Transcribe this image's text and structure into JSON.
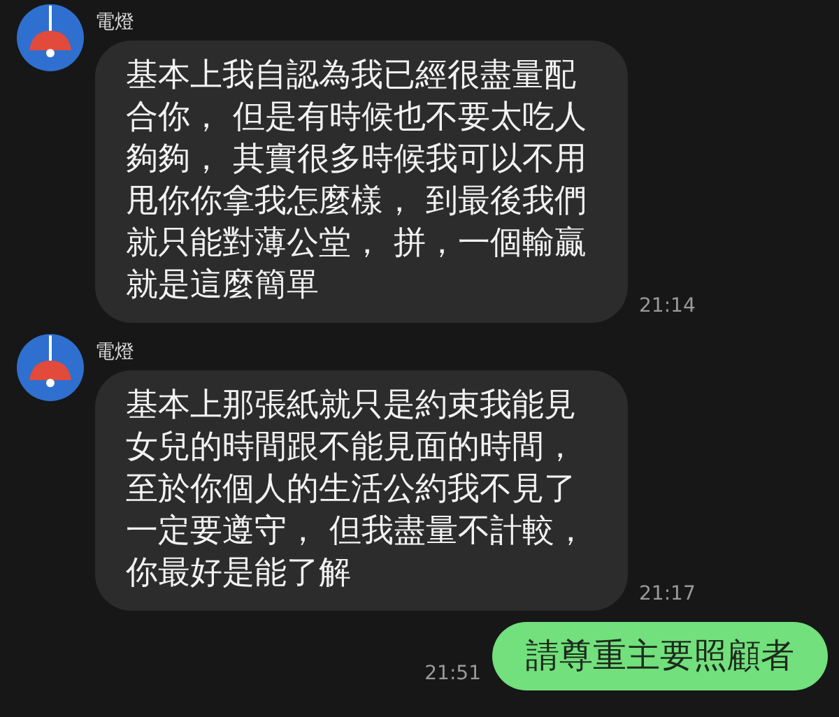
{
  "messages": [
    {
      "kind": "incoming",
      "sender": "電燈",
      "text": "基本上我自認為我已經很盡量配合你， 但是有時候也不要太吃人夠夠， 其實很多時候我可以不用甩你你拿我怎麼樣， 到最後我們就只能對薄公堂， 拼，一個輸贏就是這麼簡單",
      "time": "21:14"
    },
    {
      "kind": "incoming",
      "sender": "電燈",
      "text": "基本上那張紙就只是約束我能見女兒的時間跟不能見面的時間，至於你個人的生活公約我不見了一定要遵守， 但我盡量不計較，你最好是能了解",
      "time": "21:17"
    },
    {
      "kind": "outgoing",
      "text": "請尊重主要照顧者",
      "time": "21:51"
    }
  ]
}
